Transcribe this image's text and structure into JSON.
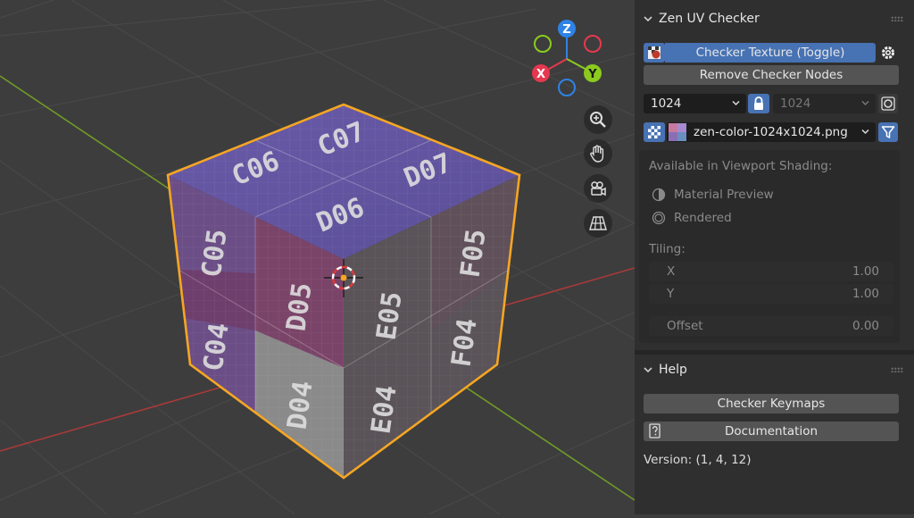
{
  "viewport": {
    "gizmo": {
      "x": "X",
      "y": "Y",
      "z": "Z",
      "x_color": "#e5384f",
      "y_color": "#8bcb1d",
      "z_color": "#2f83e6"
    },
    "cube_labels": {
      "top": [
        "C06",
        "C07",
        "D07",
        "D06"
      ],
      "left": [
        "C05",
        "D05",
        "C04",
        "D04"
      ],
      "right": [
        "E05",
        "F05",
        "E04",
        "F04"
      ]
    },
    "nav_icons": [
      "zoom-icon",
      "hand-icon",
      "camera-icon",
      "grid-icon"
    ]
  },
  "sidebar": {
    "zen_panel": {
      "title": "Zen UV Checker",
      "checker_toggle_label": "Checker Texture (Toggle)",
      "remove_nodes_label": "Remove Checker Nodes",
      "size_x": "1024",
      "size_y": "1024",
      "image_name": "zen-color-1024x1024.png",
      "viewport_shading_label": "Available in Viewport Shading:",
      "shading_options": [
        "Material Preview",
        "Rendered"
      ],
      "tiling_label": "Tiling:",
      "tiling_x_label": "X",
      "tiling_x_value": "1.00",
      "tiling_y_label": "Y",
      "tiling_y_value": "1.00",
      "offset_label": "Offset",
      "offset_value": "0.00"
    },
    "help_panel": {
      "title": "Help",
      "keymaps_label": "Checker Keymaps",
      "documentation_label": "Documentation",
      "version_text": "Version: (1, 4, 12)"
    }
  },
  "colors": {
    "accent": "#4772b3",
    "selection": "#f5a623",
    "panel_bg": "#2f2f2f",
    "viewport_bg": "#3d3d3d"
  }
}
